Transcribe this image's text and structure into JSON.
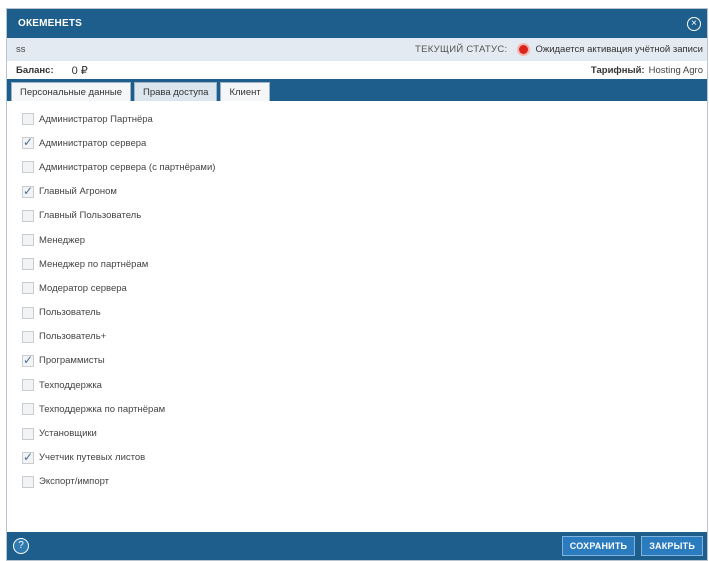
{
  "window": {
    "title": "ОКЕМЕНЕТS"
  },
  "status": {
    "user": "ss",
    "label": "ТЕКУЩИЙ СТАТУС:",
    "value": "Ожидается активация учётной записи",
    "indicator_color": "#d9241c"
  },
  "account": {
    "balance_label": "Баланс:",
    "balance_value": "0 ₽",
    "tariff_label": "Тарифный:",
    "tariff_value": "Hosting Agro"
  },
  "tabs": [
    {
      "label": "Персональные данные",
      "active": false
    },
    {
      "label": "Права доступа",
      "active": true
    },
    {
      "label": "Клиент",
      "active": false
    }
  ],
  "permissions": [
    {
      "label": "Администратор Партнёра",
      "checked": false
    },
    {
      "label": "Администратор сервера",
      "checked": true
    },
    {
      "label": "Администратор сервера (с партнёрами)",
      "checked": false
    },
    {
      "label": "Главный Агроном",
      "checked": true
    },
    {
      "label": "Главный Пользователь",
      "checked": false
    },
    {
      "label": "Менеджер",
      "checked": false
    },
    {
      "label": "Менеджер по партнёрам",
      "checked": false
    },
    {
      "label": "Модератор сервера",
      "checked": false
    },
    {
      "label": "Пользователь",
      "checked": false
    },
    {
      "label": "Пользователь+",
      "checked": false
    },
    {
      "label": "Программисты",
      "checked": true
    },
    {
      "label": "Техподдержка",
      "checked": false
    },
    {
      "label": "Техподдержка по партнёрам",
      "checked": false
    },
    {
      "label": "Установщики",
      "checked": false
    },
    {
      "label": "Учетчик путевых листов",
      "checked": true
    },
    {
      "label": "Экспорт/импорт",
      "checked": false
    }
  ],
  "footer": {
    "help_icon": "?",
    "save_label": "СОХРАНИТЬ",
    "close_label": "ЗАКРЫТЬ"
  },
  "colors": {
    "primary": "#1e5e8c",
    "button": "#2a7cbf",
    "status_bar": "#e3eaf1"
  }
}
